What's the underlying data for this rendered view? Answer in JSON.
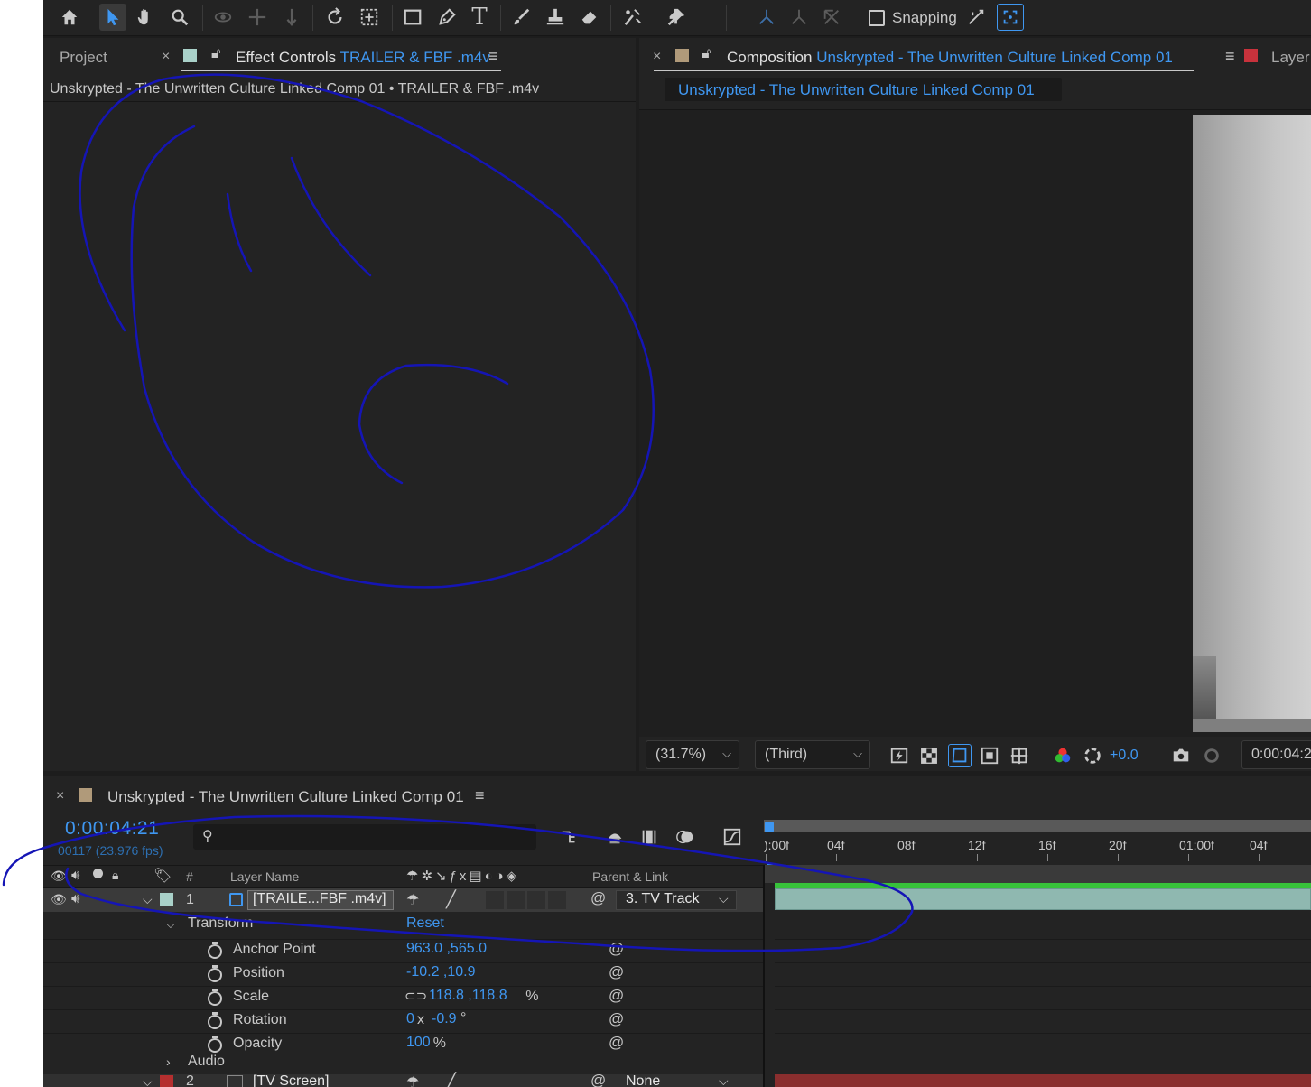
{
  "toolbar": {
    "snapping_label": "Snapping",
    "tools": [
      "home-icon",
      "selection-icon",
      "hand-icon",
      "zoom-icon",
      "orbit-icon",
      "pan-icon",
      "dolly-icon",
      "rotate-icon",
      "pan-behind-icon",
      "rectangle-icon",
      "pen-icon",
      "type-icon",
      "brush-icon",
      "clone-stamp-icon",
      "eraser-icon",
      "roto-brush-icon",
      "puppet-pin-icon"
    ]
  },
  "project_panel": {
    "project_tab": "Project",
    "effect_controls_label": "Effect Controls",
    "effect_controls_file": "TRAILER & FBF .m4v",
    "breadcrumb": "Unskrypted - The Unwritten Culture Linked Comp 01 • TRAILER & FBF .m4v"
  },
  "composition_panel": {
    "tab_label": "Composition",
    "tab_comp_name": "Unskrypted - The Unwritten Culture Linked Comp 01",
    "subtab": "Unskrypted - The Unwritten Culture Linked Comp 01",
    "layer_tab": "Layer",
    "zoom": "(31.7%)",
    "resolution": "(Third)",
    "exposure": "+0.0",
    "timecode": "0:00:04:2"
  },
  "timeline": {
    "comp_name": "Unskrypted - The Unwritten Culture Linked Comp 01",
    "current_time": "0:00:04:21",
    "frame_info": "00117 (23.976 fps)",
    "headers": {
      "number": "#",
      "layer_name": "Layer Name",
      "parent": "Parent & Link"
    },
    "ruler": [
      "):00f",
      "04f",
      "08f",
      "12f",
      "16f",
      "20f",
      "01:00f",
      "04f"
    ],
    "layers": [
      {
        "number": "1",
        "name": "[TRAILE...FBF .m4v]",
        "parent": "3. TV Track"
      },
      {
        "number": "2",
        "name": "[TV Screen]",
        "parent": "None"
      }
    ],
    "transform": {
      "label": "Transform",
      "reset": "Reset",
      "properties": [
        {
          "name": "Anchor Point",
          "value": "963.0 ,565.0"
        },
        {
          "name": "Position",
          "value": "-10.2 ,10.9"
        },
        {
          "name": "Scale",
          "value": "118.8 ,118.8",
          "unit": "%"
        },
        {
          "name": "Rotation",
          "value_a": "0",
          "mid": "x",
          "value_b": "-0.9",
          "unit": "°"
        },
        {
          "name": "Opacity",
          "value": "100",
          "unit": "%"
        }
      ]
    },
    "audio_label": "Audio"
  },
  "colors": {
    "accent_blue": "#3f97f1",
    "layer1_label": "#a9d1c9",
    "layer2_label": "#b52f2f",
    "panel_bg": "#232323",
    "annotation_ink": "#1515b5"
  }
}
